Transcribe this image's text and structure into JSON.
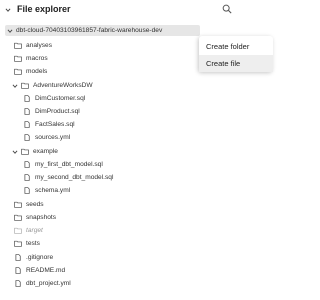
{
  "header": {
    "title": "File explorer"
  },
  "tree": {
    "root": "dbt-cloud-70403103961857-fabric-warehouse-dev",
    "analyses": "analyses",
    "macros": "macros",
    "models": "models",
    "adventureworksdw": "AdventureWorksDW",
    "dimcustomer": "DimCustomer.sql",
    "dimproduct": "DimProduct.sql",
    "factsales": "FactSales.sql",
    "sources": "sources.yml",
    "example": "example",
    "first_model": "my_first_dbt_model.sql",
    "second_model": "my_second_dbt_model.sql",
    "schema": "schema.yml",
    "seeds": "seeds",
    "snapshots": "snapshots",
    "target": "target",
    "tests": "tests",
    "gitignore": ".gitignore",
    "readme": "README.md",
    "dbt_project": "dbt_project.yml"
  },
  "context_menu": {
    "create_folder": "Create folder",
    "create_file": "Create file"
  },
  "icons": {
    "collapse": "chevron-down-icon",
    "search": "search-icon",
    "folder": "folder-icon",
    "file": "file-icon"
  }
}
